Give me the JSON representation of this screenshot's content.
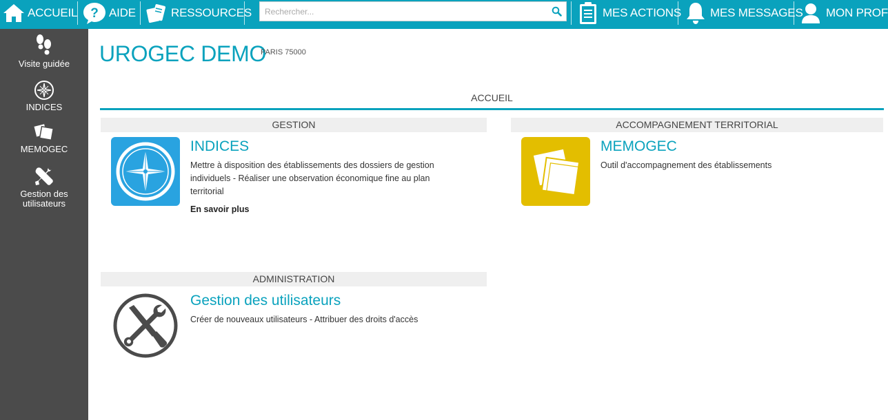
{
  "topbar": {
    "home_label": "ACCUEIL",
    "help_label": "AIDE",
    "resources_label": "RESSOURCES",
    "search_placeholder": "Rechercher...",
    "actions_label": "MES ACTIONS",
    "messages_label": "MES MESSAGES",
    "profile_label": "MON PROFIL"
  },
  "sidebar": {
    "items": [
      {
        "label": "Visite guidée",
        "icon": "footsteps-icon"
      },
      {
        "label": "INDICES",
        "icon": "compass-icon"
      },
      {
        "label": "MEMOGEC",
        "icon": "notes-icon"
      },
      {
        "label": "Gestion des utilisateurs",
        "icon": "tools-icon"
      }
    ]
  },
  "header": {
    "title": "UROGEC DEMO",
    "subtitle": "PARIS 75000"
  },
  "main": {
    "section_title": "ACCUEIL",
    "groups": {
      "gestion": "GESTION",
      "accompagnement": "ACCOMPAGNEMENT TERRITORIAL",
      "administration": "ADMINISTRATION"
    },
    "cards": {
      "indices": {
        "title": "INDICES",
        "desc1": "Mettre à disposition des établissements des dossiers de gestion",
        "desc2": "individuels - Réaliser une observation économique fine au plan",
        "desc3": "territorial",
        "more": "En savoir plus"
      },
      "memogec": {
        "title": "MEMOGEC",
        "desc1": "Outil d'accompagnement des établissements"
      },
      "users": {
        "title": "Gestion des utilisateurs",
        "desc1": "Créer de nouveaux utilisateurs - Attribuer des droits d'accès"
      }
    }
  },
  "colors": {
    "accent": "#0aa2bd",
    "sidebar_bg": "#4b4b4b",
    "indices_blue": "#29a3e0",
    "memogec_yellow": "#e3be00",
    "group_header_bg": "#efefef"
  }
}
